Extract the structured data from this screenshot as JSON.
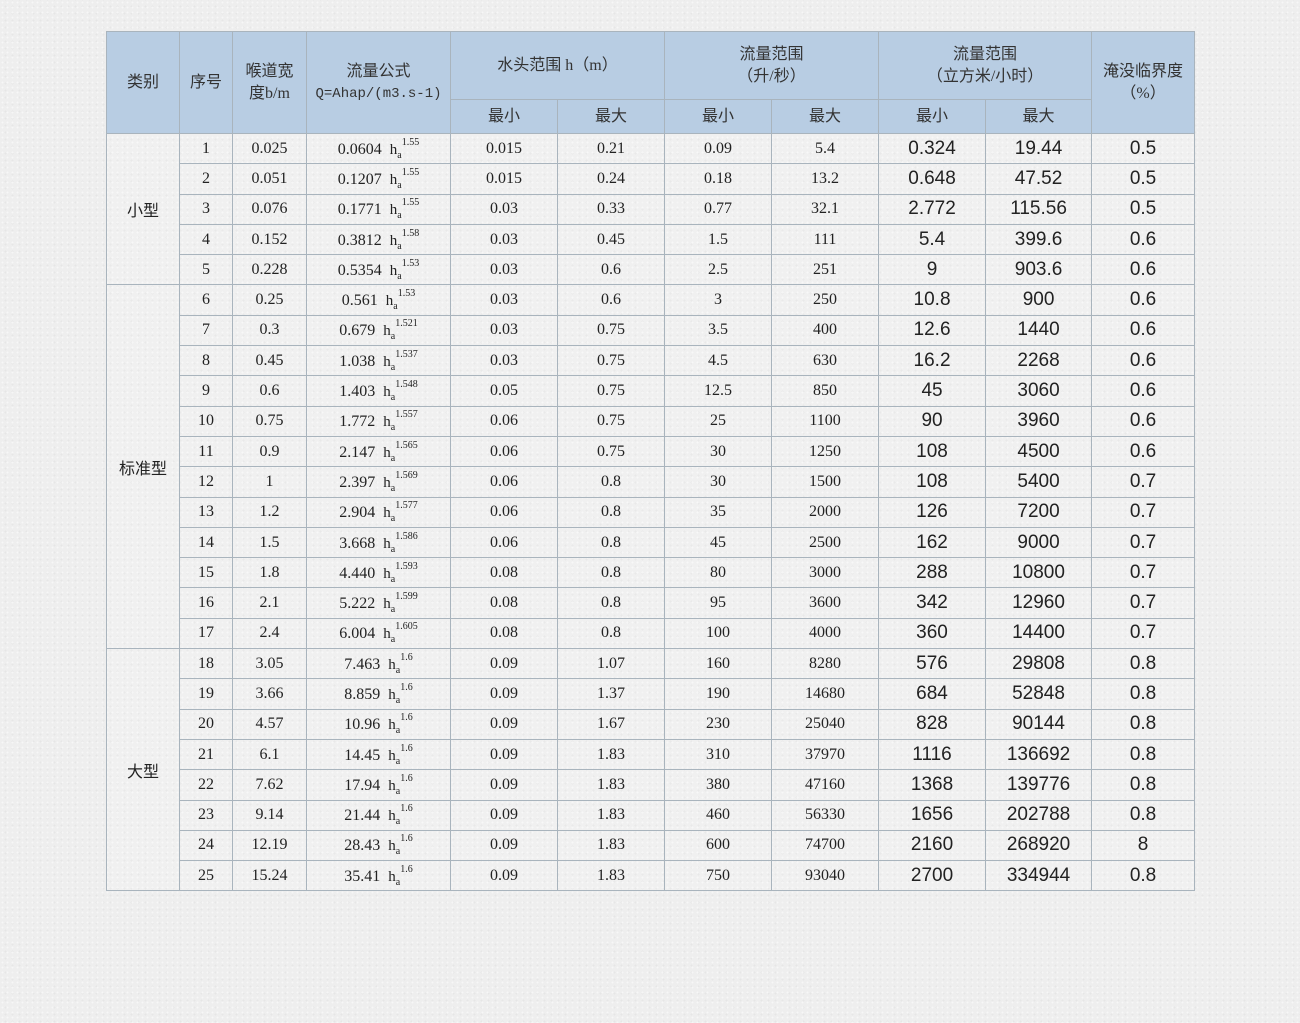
{
  "headers": {
    "category": "类别",
    "seq": "序号",
    "throat_width": "喉道宽度b/m",
    "formula_title": "流量公式",
    "formula_expr": "Q=Ahap/(m3.s-1)",
    "head_range": "水头范围 h（m）",
    "flow_ls_title": "流量范围",
    "flow_ls_unit": "（升/秒）",
    "flow_m3h_title": "流量范围",
    "flow_m3h_unit": "（立方米/小时）",
    "submergence_title": "淹没临界度",
    "submergence_unit": "（%）",
    "min": "最小",
    "max": "最大"
  },
  "formula_symbol": {
    "h": "h",
    "sub": "a"
  },
  "groups": [
    {
      "name": "小型",
      "rows": [
        {
          "seq": "1",
          "b": "0.025",
          "coef": "0.0604",
          "exp": "1.55",
          "hmin": "0.015",
          "hmax": "0.21",
          "qmin": "0.09",
          "qmax": "5.4",
          "qmin_m3": "0.324",
          "qmax_m3": "19.44",
          "sub": "0.5"
        },
        {
          "seq": "2",
          "b": "0.051",
          "coef": "0.1207",
          "exp": "1.55",
          "hmin": "0.015",
          "hmax": "0.24",
          "qmin": "0.18",
          "qmax": "13.2",
          "qmin_m3": "0.648",
          "qmax_m3": "47.52",
          "sub": "0.5"
        },
        {
          "seq": "3",
          "b": "0.076",
          "coef": "0.1771",
          "exp": "1.55",
          "hmin": "0.03",
          "hmax": "0.33",
          "qmin": "0.77",
          "qmax": "32.1",
          "qmin_m3": "2.772",
          "qmax_m3": "115.56",
          "sub": "0.5"
        },
        {
          "seq": "4",
          "b": "0.152",
          "coef": "0.3812",
          "exp": "1.58",
          "hmin": "0.03",
          "hmax": "0.45",
          "qmin": "1.5",
          "qmax": "111",
          "qmin_m3": "5.4",
          "qmax_m3": "399.6",
          "sub": "0.6"
        },
        {
          "seq": "5",
          "b": "0.228",
          "coef": "0.5354",
          "exp": "1.53",
          "hmin": "0.03",
          "hmax": "0.6",
          "qmin": "2.5",
          "qmax": "251",
          "qmin_m3": "9",
          "qmax_m3": "903.6",
          "sub": "0.6"
        }
      ]
    },
    {
      "name": "标准型",
      "rows": [
        {
          "seq": "6",
          "b": "0.25",
          "coef": "0.561",
          "exp": "1.53",
          "hmin": "0.03",
          "hmax": "0.6",
          "qmin": "3",
          "qmax": "250",
          "qmin_m3": "10.8",
          "qmax_m3": "900",
          "sub": "0.6"
        },
        {
          "seq": "7",
          "b": "0.3",
          "coef": "0.679",
          "exp": "1.521",
          "hmin": "0.03",
          "hmax": "0.75",
          "qmin": "3.5",
          "qmax": "400",
          "qmin_m3": "12.6",
          "qmax_m3": "1440",
          "sub": "0.6"
        },
        {
          "seq": "8",
          "b": "0.45",
          "coef": "1.038",
          "exp": "1.537",
          "hmin": "0.03",
          "hmax": "0.75",
          "qmin": "4.5",
          "qmax": "630",
          "qmin_m3": "16.2",
          "qmax_m3": "2268",
          "sub": "0.6"
        },
        {
          "seq": "9",
          "b": "0.6",
          "coef": "1.403",
          "exp": "1.548",
          "hmin": "0.05",
          "hmax": "0.75",
          "qmin": "12.5",
          "qmax": "850",
          "qmin_m3": "45",
          "qmax_m3": "3060",
          "sub": "0.6"
        },
        {
          "seq": "10",
          "b": "0.75",
          "coef": "1.772",
          "exp": "1.557",
          "hmin": "0.06",
          "hmax": "0.75",
          "qmin": "25",
          "qmax": "1100",
          "qmin_m3": "90",
          "qmax_m3": "3960",
          "sub": "0.6"
        },
        {
          "seq": "11",
          "b": "0.9",
          "coef": "2.147",
          "exp": "1.565",
          "hmin": "0.06",
          "hmax": "0.75",
          "qmin": "30",
          "qmax": "1250",
          "qmin_m3": "108",
          "qmax_m3": "4500",
          "sub": "0.6"
        },
        {
          "seq": "12",
          "b": "1",
          "coef": "2.397",
          "exp": "1.569",
          "hmin": "0.06",
          "hmax": "0.8",
          "qmin": "30",
          "qmax": "1500",
          "qmin_m3": "108",
          "qmax_m3": "5400",
          "sub": "0.7"
        },
        {
          "seq": "13",
          "b": "1.2",
          "coef": "2.904",
          "exp": "1.577",
          "hmin": "0.06",
          "hmax": "0.8",
          "qmin": "35",
          "qmax": "2000",
          "qmin_m3": "126",
          "qmax_m3": "7200",
          "sub": "0.7"
        },
        {
          "seq": "14",
          "b": "1.5",
          "coef": "3.668",
          "exp": "1.586",
          "hmin": "0.06",
          "hmax": "0.8",
          "qmin": "45",
          "qmax": "2500",
          "qmin_m3": "162",
          "qmax_m3": "9000",
          "sub": "0.7"
        },
        {
          "seq": "15",
          "b": "1.8",
          "coef": "4.440",
          "exp": "1.593",
          "hmin": "0.08",
          "hmax": "0.8",
          "qmin": "80",
          "qmax": "3000",
          "qmin_m3": "288",
          "qmax_m3": "10800",
          "sub": "0.7"
        },
        {
          "seq": "16",
          "b": "2.1",
          "coef": "5.222",
          "exp": "1.599",
          "hmin": "0.08",
          "hmax": "0.8",
          "qmin": "95",
          "qmax": "3600",
          "qmin_m3": "342",
          "qmax_m3": "12960",
          "sub": "0.7"
        },
        {
          "seq": "17",
          "b": "2.4",
          "coef": "6.004",
          "exp": "1.605",
          "hmin": "0.08",
          "hmax": "0.8",
          "qmin": "100",
          "qmax": "4000",
          "qmin_m3": "360",
          "qmax_m3": "14400",
          "sub": "0.7"
        }
      ]
    },
    {
      "name": "大型",
      "rows": [
        {
          "seq": "18",
          "b": "3.05",
          "coef": "7.463",
          "exp": "1.6",
          "hmin": "0.09",
          "hmax": "1.07",
          "qmin": "160",
          "qmax": "8280",
          "qmin_m3": "576",
          "qmax_m3": "29808",
          "sub": "0.8"
        },
        {
          "seq": "19",
          "b": "3.66",
          "coef": "8.859",
          "exp": "1.6",
          "hmin": "0.09",
          "hmax": "1.37",
          "qmin": "190",
          "qmax": "14680",
          "qmin_m3": "684",
          "qmax_m3": "52848",
          "sub": "0.8"
        },
        {
          "seq": "20",
          "b": "4.57",
          "coef": "10.96",
          "exp": "1.6",
          "hmin": "0.09",
          "hmax": "1.67",
          "qmin": "230",
          "qmax": "25040",
          "qmin_m3": "828",
          "qmax_m3": "90144",
          "sub": "0.8"
        },
        {
          "seq": "21",
          "b": "6.1",
          "coef": "14.45",
          "exp": "1.6",
          "hmin": "0.09",
          "hmax": "1.83",
          "qmin": "310",
          "qmax": "37970",
          "qmin_m3": "1116",
          "qmax_m3": "136692",
          "sub": "0.8"
        },
        {
          "seq": "22",
          "b": "7.62",
          "coef": "17.94",
          "exp": "1.6",
          "hmin": "0.09",
          "hmax": "1.83",
          "qmin": "380",
          "qmax": "47160",
          "qmin_m3": "1368",
          "qmax_m3": "139776",
          "sub": "0.8"
        },
        {
          "seq": "23",
          "b": "9.14",
          "coef": "21.44",
          "exp": "1.6",
          "hmin": "0.09",
          "hmax": "1.83",
          "qmin": "460",
          "qmax": "56330",
          "qmin_m3": "1656",
          "qmax_m3": "202788",
          "sub": "0.8"
        },
        {
          "seq": "24",
          "b": "12.19",
          "coef": "28.43",
          "exp": "1.6",
          "hmin": "0.09",
          "hmax": "1.83",
          "qmin": "600",
          "qmax": "74700",
          "qmin_m3": "2160",
          "qmax_m3": "268920",
          "sub": "8"
        },
        {
          "seq": "25",
          "b": "15.24",
          "coef": "35.41",
          "exp": "1.6",
          "hmin": "0.09",
          "hmax": "1.83",
          "qmin": "750",
          "qmax": "93040",
          "qmin_m3": "2700",
          "qmax_m3": "334944",
          "sub": "0.8"
        }
      ]
    }
  ],
  "colors": {
    "header_bg": "#b8cde3",
    "border": "#a9b4bd",
    "page_bg": "#eeeeee"
  }
}
